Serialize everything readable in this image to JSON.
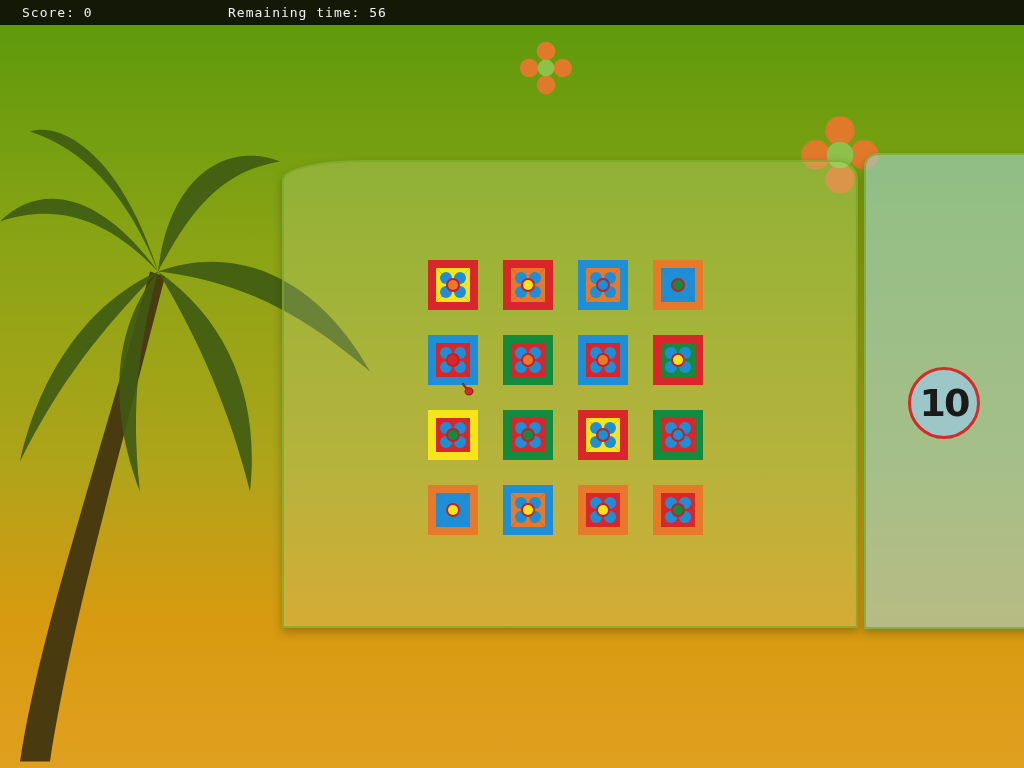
{
  "status_bar": {
    "score": "Score: 0",
    "remaining_time": "Remaining time: 56"
  },
  "board": {
    "tiles": [
      {
        "frame": {
          "color": "#d8262a"
        },
        "pattern": {
          "color": "#f5e51a"
        },
        "center": {
          "color": "#e8792a"
        }
      },
      {
        "frame": {
          "color": "#d8262a"
        },
        "pattern": {
          "color": "#e8792a"
        },
        "center": {
          "color": "#f5e51a"
        }
      },
      {
        "frame": {
          "color": "#1e8fd6"
        },
        "pattern": {
          "color": "#e8792a"
        },
        "center": {
          "color": "#1e8fd6"
        }
      },
      {
        "frame": {
          "color": "#e8792a"
        },
        "pattern": {
          "color": "#1e8fd6"
        },
        "center": {
          "color": "#138a3e"
        }
      },
      {
        "frame": {
          "color": "#1e8fd6"
        },
        "pattern": {
          "color": "#d8262a"
        },
        "center": {
          "color": "#d8262a"
        }
      },
      {
        "frame": {
          "color": "#138a3e"
        },
        "pattern": {
          "color": "#d8262a"
        },
        "center": {
          "color": "#e8792a"
        }
      },
      {
        "frame": {
          "color": "#1e8fd6"
        },
        "pattern": {
          "color": "#d8262a"
        },
        "center": {
          "color": "#e8792a"
        }
      },
      {
        "frame": {
          "color": "#d8262a"
        },
        "pattern": {
          "color": "#138a3e"
        },
        "center": {
          "color": "#f5e51a"
        }
      },
      {
        "frame": {
          "color": "#f5e51a"
        },
        "pattern": {
          "color": "#d8262a"
        },
        "center": {
          "color": "#138a3e"
        }
      },
      {
        "frame": {
          "color": "#138a3e"
        },
        "pattern": {
          "color": "#d8262a"
        },
        "center": {
          "color": "#138a3e"
        }
      },
      {
        "frame": {
          "color": "#d8262a"
        },
        "pattern": {
          "color": "#f5e51a"
        },
        "center": {
          "color": "#1e8fd6"
        }
      },
      {
        "frame": {
          "color": "#138a3e"
        },
        "pattern": {
          "color": "#d8262a"
        },
        "center": {
          "color": "#1e8fd6"
        }
      },
      {
        "frame": {
          "color": "#e8792a"
        },
        "pattern": {
          "color": "#1e8fd6"
        },
        "center": {
          "color": "#f5e51a"
        }
      },
      {
        "frame": {
          "color": "#1e8fd6"
        },
        "pattern": {
          "color": "#e8792a"
        },
        "center": {
          "color": "#f5e51a"
        }
      },
      {
        "frame": {
          "color": "#e8792a"
        },
        "pattern": {
          "color": "#d8262a"
        },
        "center": {
          "color": "#f5e51a"
        }
      },
      {
        "frame": {
          "color": "#e8792a"
        },
        "pattern": {
          "color": "#d8262a"
        },
        "center": {
          "color": "#138a3e"
        }
      }
    ]
  },
  "side_panel": {
    "counter": "10"
  }
}
